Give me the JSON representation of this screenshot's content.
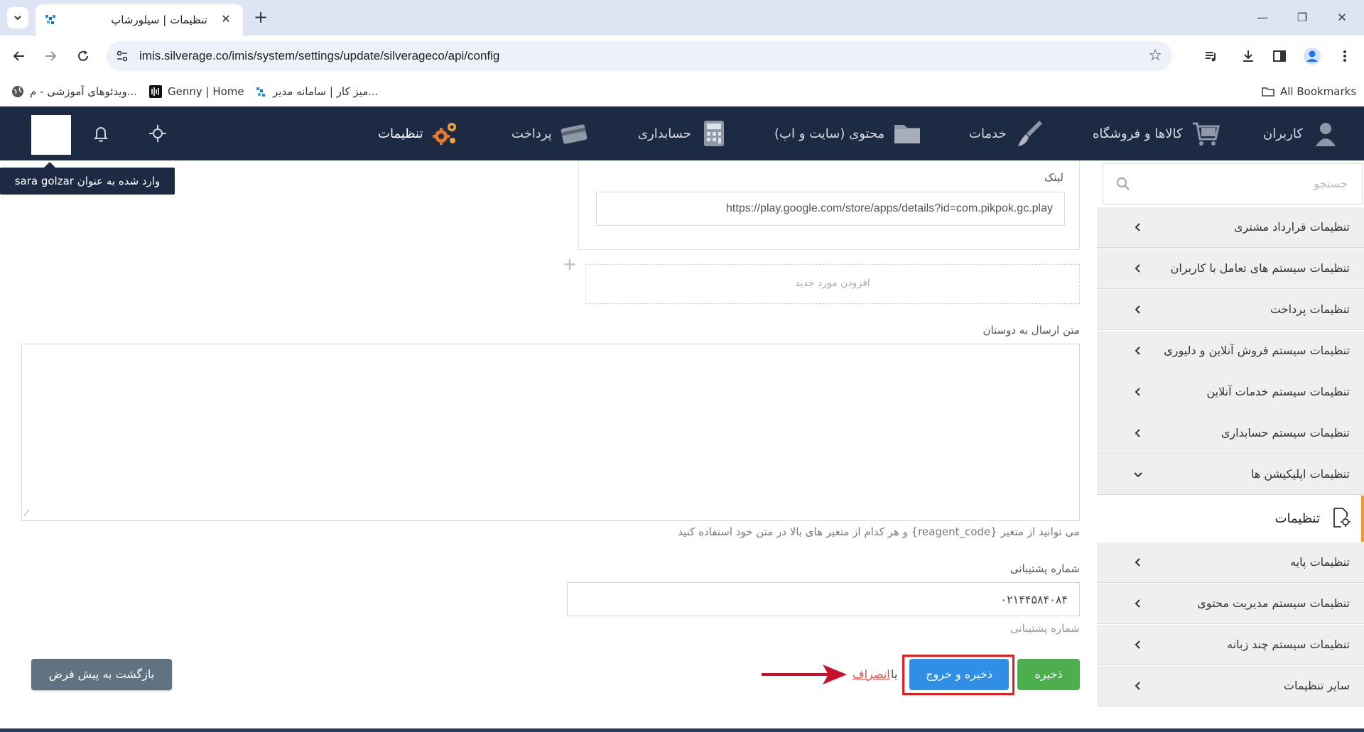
{
  "browser": {
    "tab_title": "تنظیمات | سیلورشاپ",
    "url": "imis.silverage.co/imis/system/settings/update/silverageco/api/config",
    "bookmarks": [
      {
        "label": "ویدئوهای آموزشی - م...",
        "icon": "globe-icon"
      },
      {
        "label": "Genny | Home",
        "icon": "genny-icon"
      },
      {
        "label": "میز کار | سامانه مدیر...",
        "icon": "silverage-icon"
      }
    ],
    "all_bookmarks": "All Bookmarks"
  },
  "nav": {
    "items": [
      {
        "label": "کاربران",
        "icon": "users-icon"
      },
      {
        "label": "کالاها و فروشگاه",
        "icon": "cart-icon"
      },
      {
        "label": "خدمات",
        "icon": "brush-icon"
      },
      {
        "label": "محتوی (سایت و اپ)",
        "icon": "folder-icon"
      },
      {
        "label": "حسابداری",
        "icon": "calculator-icon"
      },
      {
        "label": "پرداخت",
        "icon": "card-icon"
      },
      {
        "label": "تنظیمات",
        "icon": "gears-icon"
      }
    ],
    "tooltip": "وارد شده به عنوان sara golzar"
  },
  "sidebar": {
    "search_placeholder": "جستجو",
    "items_top": [
      "تنظیمات قرارداد مشتری",
      "تنظیمات سیستم های تعامل با کاربران",
      "تنظیمات پرداخت",
      "تنظیمات سیستم فروش آنلاین و دلیوری",
      "تنظیمات سیستم خدمات آنلاین",
      "تنظیمات سیستم حسابداری",
      "تنظیمات اپلیکیشن ها"
    ],
    "active_item": "تنظیمات",
    "items_bottom": [
      "تنظیمات پایه",
      "تنظیمات سیستم مدیریت محتوی",
      "تنظیمات سیستم چند زبانه",
      "سایر تنظیمات"
    ]
  },
  "form": {
    "link_label": "لینک",
    "link_value": "https://play.google.com/store/apps/details?id=com.pikpok.gc.play",
    "add_new": "افزودن مورد جدید",
    "friends_label": "متن ارسال به دوستان",
    "friends_value": "",
    "hint": "می توانید از متغیر {reagent_code} و هر کدام از متغیر های بالا در متن خود استفاده کنید",
    "support_label": "شماره پشتیبانی",
    "support_value": "۰۲۱۴۴۵۸۴۰۸۴",
    "support_help": "شماره پشتیبانی"
  },
  "actions": {
    "save": "ذخیره",
    "save_exit": "ذخیره و خروج",
    "or": "یا",
    "cancel": "انصراف",
    "reset": "بازگشت به پیش فرض"
  },
  "colors": {
    "nav_bg": "#1c2a43",
    "save": "#4cae4c",
    "save_exit": "#2f8ee5",
    "highlight": "#e02020",
    "accent": "#f39a2e"
  }
}
